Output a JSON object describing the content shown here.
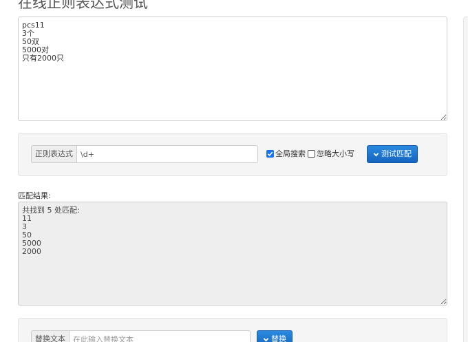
{
  "page": {
    "title": "在线正则表达式测试"
  },
  "source": {
    "text": "pcs11\n3个\n50双\n5000对\n只有2000只"
  },
  "regex": {
    "addon_label": "正则表达式",
    "value": "\\d+",
    "global_label": "全局搜索",
    "global_checked": true,
    "ignore_case_label": "忽略大小写",
    "ignore_case_checked": false,
    "test_button_label": "测试匹配"
  },
  "result": {
    "label": "匹配结果:",
    "text": "共找到 5 处匹配:\n11\n3\n50\n5000\n2000"
  },
  "replace": {
    "addon_label": "替换文本",
    "placeholder": "在此输入替换文本",
    "value": "",
    "button_label": "替换"
  },
  "colors": {
    "primary": "#1a73c8",
    "well_bg": "#f5f5f5",
    "result_bg": "#eeeeee"
  }
}
